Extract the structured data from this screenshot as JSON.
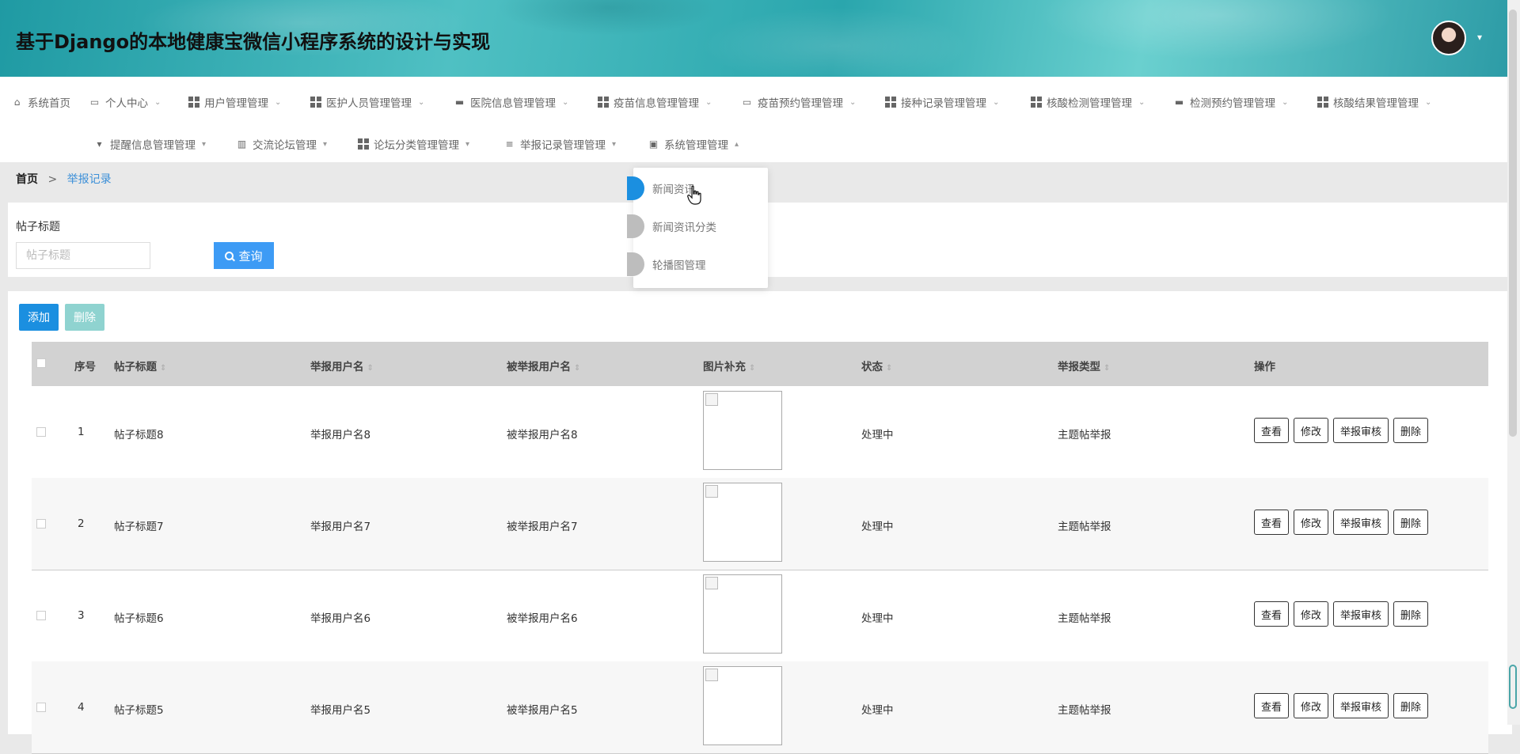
{
  "header": {
    "title": "基于Django的本地健康宝微信小程序系统的设计与实现",
    "avatar_caret": "▾"
  },
  "nav": {
    "row1": [
      {
        "label": "系统首页",
        "icon": "home-icon",
        "caret": false
      },
      {
        "label": "个人中心",
        "icon": "profile-icon",
        "caret": true
      },
      {
        "label": "用户管理管理",
        "icon": "grid-icon",
        "caret": true
      },
      {
        "label": "医护人员管理管理",
        "icon": "grid-icon",
        "caret": true
      },
      {
        "label": "医院信息管理管理",
        "icon": "chat-icon",
        "caret": true
      },
      {
        "label": "疫苗信息管理管理",
        "icon": "grid-icon",
        "caret": true
      },
      {
        "label": "疫苗预约管理管理",
        "icon": "monitor-icon",
        "caret": true
      },
      {
        "label": "接种记录管理管理",
        "icon": "grid-icon",
        "caret": true
      },
      {
        "label": "核酸检测管理管理",
        "icon": "grid-icon",
        "caret": true
      },
      {
        "label": "检测预约管理管理",
        "icon": "ticket-icon",
        "caret": true
      },
      {
        "label": "核酸结果管理管理",
        "icon": "grid-icon",
        "caret": true
      }
    ],
    "row2": [
      {
        "label": "提醒信息管理管理",
        "icon": "brush-icon",
        "caret": "▾"
      },
      {
        "label": "交流论坛管理",
        "icon": "book-icon",
        "caret": "▾"
      },
      {
        "label": "论坛分类管理管理",
        "icon": "grid-icon",
        "caret": "▾"
      },
      {
        "label": "举报记录管理管理",
        "icon": "sliders-icon",
        "caret": "▾"
      },
      {
        "label": "系统管理管理",
        "icon": "clipboard-icon",
        "caret": "▴"
      }
    ]
  },
  "dropdown": {
    "items": [
      {
        "label": "新闻资讯",
        "active": true
      },
      {
        "label": "新闻资讯分类",
        "active": false
      },
      {
        "label": "轮播图管理",
        "active": false
      }
    ]
  },
  "breadcrumb": {
    "home": "首页",
    "separator": ">",
    "current": "举报记录"
  },
  "search": {
    "label": "帖子标题",
    "placeholder": "帖子标题",
    "value": "",
    "button": "查询"
  },
  "toolbar": {
    "add": "添加",
    "delete": "删除"
  },
  "table": {
    "columns": [
      "序号",
      "帖子标题",
      "举报用户名",
      "被举报用户名",
      "图片补充",
      "状态",
      "举报类型",
      "操作"
    ],
    "sort_glyph": "⇕",
    "rows": [
      {
        "index": "1",
        "title": "帖子标题8",
        "reporter": "举报用户名8",
        "reported": "被举报用户名8",
        "status": "处理中",
        "type": "主题帖举报"
      },
      {
        "index": "2",
        "title": "帖子标题7",
        "reporter": "举报用户名7",
        "reported": "被举报用户名7",
        "status": "处理中",
        "type": "主题帖举报"
      },
      {
        "index": "3",
        "title": "帖子标题6",
        "reporter": "举报用户名6",
        "reported": "被举报用户名6",
        "status": "处理中",
        "type": "主题帖举报"
      },
      {
        "index": "4",
        "title": "帖子标题5",
        "reporter": "举报用户名5",
        "reported": "被举报用户名5",
        "status": "处理中",
        "type": "主题帖举报"
      }
    ],
    "actions": [
      "查看",
      "修改",
      "举报审核",
      "删除"
    ]
  },
  "colors": {
    "primary": "#1b8fe0",
    "search_button": "#3d9bf5",
    "delete_disabled": "#8fd3d0",
    "header_teal": "#2aa6ad"
  }
}
